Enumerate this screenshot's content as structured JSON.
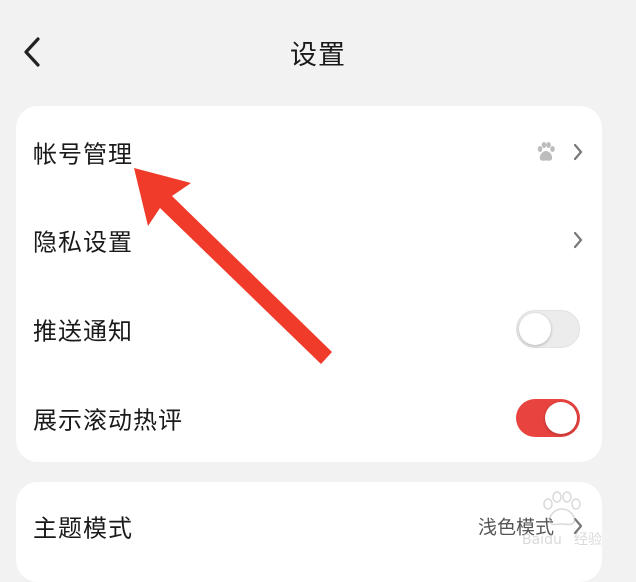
{
  "header": {
    "title": "设置",
    "back_icon": "chevron-left-icon"
  },
  "settings_group_1": [
    {
      "label": "帐号管理",
      "control": "chevron",
      "extra_icon": "baidu-paw-icon"
    },
    {
      "label": "隐私设置",
      "control": "chevron"
    },
    {
      "label": "推送通知",
      "control": "toggle",
      "toggle_on": false
    },
    {
      "label": "展示滚动热评",
      "control": "toggle",
      "toggle_on": true
    }
  ],
  "settings_group_2": [
    {
      "label": "主题模式",
      "value": "浅色模式",
      "control": "chevron"
    }
  ],
  "colors": {
    "background": "#f2f2f2",
    "card": "#ffffff",
    "accent_red": "#e8433f",
    "toggle_off": "#ececec",
    "annotation_arrow": "#f03a2a"
  },
  "watermark": {
    "brand": "Baidu",
    "suffix": "经验"
  }
}
